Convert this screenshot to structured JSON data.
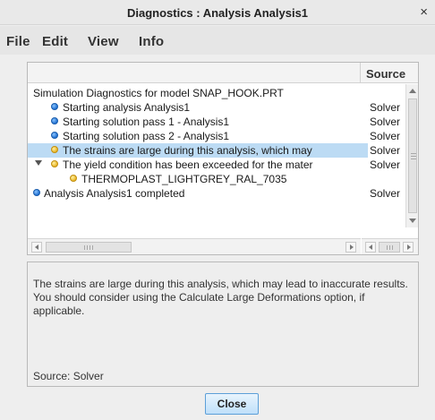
{
  "window": {
    "title": "Diagnostics : Analysis Analysis1",
    "close_glyph": "×"
  },
  "menu": [
    "File",
    "Edit",
    "View",
    "Info"
  ],
  "list": {
    "column_source": "Source",
    "rows": [
      {
        "message": "Simulation Diagnostics for model SNAP_HOOK.PRT",
        "source": "",
        "icon": "none"
      },
      {
        "message": "Starting analysis Analysis1",
        "source": "Solver",
        "icon": "info-dot-blue"
      },
      {
        "message": "Starting solution pass 1 - Analysis1",
        "source": "Solver",
        "icon": "info-dot-blue"
      },
      {
        "message": "Starting solution pass 2 - Analysis1",
        "source": "Solver",
        "icon": "info-dot-blue"
      },
      {
        "message": "The strains are large during this analysis, which may",
        "source": "Solver",
        "icon": "warning-dot-yellow",
        "selected": true
      },
      {
        "message": "The yield condition has been exceeded for the mater",
        "source": "Solver",
        "icon": "warning-dot-yellow"
      },
      {
        "message": "THERMOPLAST_LIGHTGREY_RAL_7035",
        "source": "",
        "icon": "warning-dot-yellow"
      },
      {
        "message": "Analysis Analysis1 completed",
        "source": "Solver",
        "icon": "info-dot-blue"
      }
    ]
  },
  "details": {
    "text": "The strains are large during this analysis, which may lead to inaccurate results. You should consider using the Calculate Large Deformations option, if applicable.",
    "source": "Source: Solver"
  },
  "buttons": {
    "close": "Close"
  },
  "colors": {
    "selection": "#bcdbf4",
    "accent": "#5c9fd8",
    "info": "#1f6fd1",
    "warning": "#e9b525"
  }
}
